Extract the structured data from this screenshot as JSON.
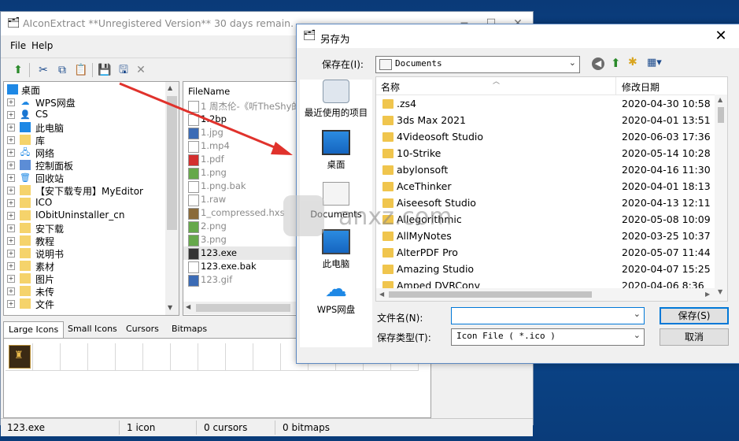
{
  "app": {
    "title": "AIconExtract  **Unregistered Version** 30 days remain.",
    "menu": [
      "File",
      "Help"
    ],
    "tree": [
      {
        "label": "桌面",
        "icon": "desktop"
      },
      {
        "label": "WPS网盘",
        "icon": "cloud"
      },
      {
        "label": "CS",
        "icon": "user"
      },
      {
        "label": "此电脑",
        "icon": "computer"
      },
      {
        "label": "库",
        "icon": "library"
      },
      {
        "label": "网络",
        "icon": "network"
      },
      {
        "label": "控制面板",
        "icon": "control-panel"
      },
      {
        "label": "回收站",
        "icon": "recycle-bin"
      },
      {
        "label": "【安下载专用】MyEditor",
        "icon": "folder"
      },
      {
        "label": "ICO",
        "icon": "folder"
      },
      {
        "label": "IObitUninstaller_cn",
        "icon": "folder"
      },
      {
        "label": "安下载",
        "icon": "folder"
      },
      {
        "label": "教程",
        "icon": "folder"
      },
      {
        "label": "说明书",
        "icon": "folder"
      },
      {
        "label": "素材",
        "icon": "folder"
      },
      {
        "label": "图片",
        "icon": "folder"
      },
      {
        "label": "未传",
        "icon": "folder"
      },
      {
        "label": "文件",
        "icon": "folder"
      }
    ],
    "files_header": "FileName",
    "files": [
      {
        "name": "1 周杰伦-《听TheShy的",
        "icon": "doc",
        "dim": true
      },
      {
        "name": "1.2bp",
        "icon": "doc",
        "dim": false
      },
      {
        "name": "1.jpg",
        "icon": "jpg",
        "dim": true
      },
      {
        "name": "1.mp4",
        "icon": "doc",
        "dim": true
      },
      {
        "name": "1.pdf",
        "icon": "pdf",
        "dim": true
      },
      {
        "name": "1.png",
        "icon": "png",
        "dim": true
      },
      {
        "name": "1.png.bak",
        "icon": "doc",
        "dim": true
      },
      {
        "name": "1.raw",
        "icon": "doc",
        "dim": true
      },
      {
        "name": "1_compressed.hxs",
        "icon": "hxs",
        "dim": true
      },
      {
        "name": "2.png",
        "icon": "png",
        "dim": true
      },
      {
        "name": "3.png",
        "icon": "png",
        "dim": true
      },
      {
        "name": "123.exe",
        "icon": "exe",
        "dim": false
      },
      {
        "name": "123.exe.bak",
        "icon": "doc",
        "dim": false
      },
      {
        "name": "123.gif",
        "icon": "gif",
        "dim": true
      }
    ],
    "tabs": [
      "Large Icons",
      "Small Icons",
      "Cursors",
      "Bitmaps"
    ],
    "status": {
      "file": "123.exe",
      "icons": "1 icon",
      "cursors": "0 cursors",
      "bitmaps": "0 bitmaps"
    }
  },
  "dialog": {
    "title": "另存为",
    "save_in_label": "保存在(I):",
    "save_in_value": "Documents",
    "places": [
      {
        "label": "最近使用的项目",
        "icon": "recent"
      },
      {
        "label": "桌面",
        "icon": "desktop"
      },
      {
        "label": "Documents",
        "icon": "documents"
      },
      {
        "label": "此电脑",
        "icon": "computer"
      },
      {
        "label": "WPS网盘",
        "icon": "cloud"
      }
    ],
    "columns": {
      "name": "名称",
      "date": "修改日期"
    },
    "rows": [
      {
        "name": ".zs4",
        "date": "2020-04-30 10:58"
      },
      {
        "name": "3ds Max 2021",
        "date": "2020-04-01 13:51"
      },
      {
        "name": "4Videosoft Studio",
        "date": "2020-06-03 17:36"
      },
      {
        "name": "10-Strike",
        "date": "2020-05-14 10:28"
      },
      {
        "name": "abylonsoft",
        "date": "2020-04-16 11:30"
      },
      {
        "name": "AceThinker",
        "date": "2020-04-01 18:13"
      },
      {
        "name": "Aiseesoft Studio",
        "date": "2020-04-13 12:11"
      },
      {
        "name": "Allegorithmic",
        "date": "2020-05-08 10:09"
      },
      {
        "name": "AllMyNotes",
        "date": "2020-03-25 10:37"
      },
      {
        "name": "AlterPDF Pro",
        "date": "2020-05-07 11:44"
      },
      {
        "name": "Amazing Studio",
        "date": "2020-04-07 15:25"
      },
      {
        "name": "Amped DVRConv",
        "date": "2020-04-06 8:36"
      }
    ],
    "filename_label": "文件名(N):",
    "filename_value": "",
    "filetype_label": "保存类型(T):",
    "filetype_value": "Icon File ( *.ico )",
    "save_button": "保存(S)",
    "cancel_button": "取消"
  },
  "watermark": {
    "text": "anxz.com"
  },
  "colors": {
    "desktop": "#0b4f9a",
    "accent": "#0078d7",
    "arrow": "#e0322c",
    "folder": "#f0c54d"
  }
}
